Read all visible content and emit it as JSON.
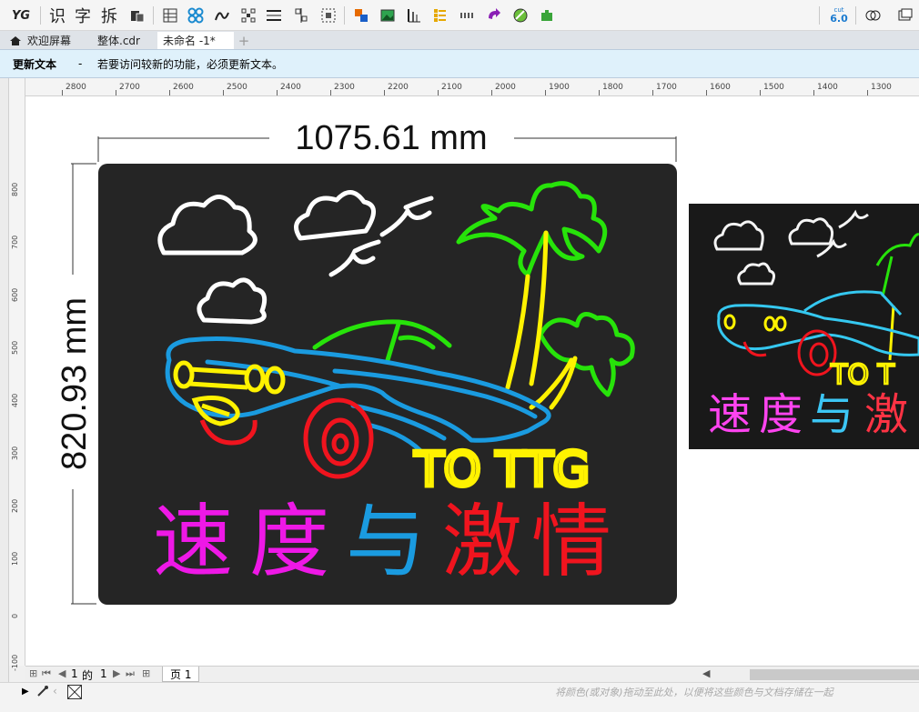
{
  "toolbar": {
    "text_tools": [
      "识",
      "字",
      "拆"
    ],
    "buttons": [
      "yg-logo-icon",
      "copy-icon",
      "table-icon",
      "pattern-icon",
      "curve-icon",
      "nodes-icon",
      "align-icon",
      "distribute-icon",
      "grid-icon",
      "color-icon",
      "image-icon",
      "dimension-icon",
      "list-icon",
      "dots-icon",
      "arrow-icon",
      "ball-icon",
      "puzzle-icon"
    ],
    "version_badge_top": "cut",
    "version_badge": "6.0"
  },
  "tabs": [
    {
      "label": "欢迎屏幕"
    },
    {
      "label": "整体.cdr"
    },
    {
      "label": "未命名 -1*"
    },
    {
      "label": "+"
    }
  ],
  "update": {
    "title": "更新文本",
    "separator": "-",
    "message": "若要访问较新的功能，必须更新文本。"
  },
  "ruler": {
    "h_labels": [
      "2800",
      "2700",
      "2600",
      "2500",
      "2400",
      "2300",
      "2200",
      "2100",
      "2000",
      "1900",
      "1800",
      "1700",
      "1600",
      "1500",
      "1400",
      "1300"
    ],
    "v_labels": [
      "800",
      "700",
      "600",
      "500",
      "400",
      "300",
      "200",
      "100",
      "0",
      "-100"
    ]
  },
  "design": {
    "width_dim": "1075.61 mm",
    "height_dim": "820.93 mm",
    "to_ttg": "TO TTG",
    "chars": [
      "速",
      "度",
      "与",
      "激",
      "情"
    ],
    "colors": {
      "bg": "#252525",
      "white": "#ffffff",
      "green": "#27e30a",
      "yellow": "#fff200",
      "blue": "#1a9be0",
      "red": "#f0141e",
      "magenta": "#ee18e6"
    }
  },
  "preview": {
    "to_ttg": "TO T",
    "chars": [
      "速",
      "度",
      "与",
      "激"
    ]
  },
  "pager": {
    "current": "1",
    "of_label": "的",
    "total": "1",
    "page_tab": "页 1"
  },
  "status": {
    "hint": "将颜色(或对象)拖动至此处，以便将这些颜色与文档存储在一起"
  }
}
